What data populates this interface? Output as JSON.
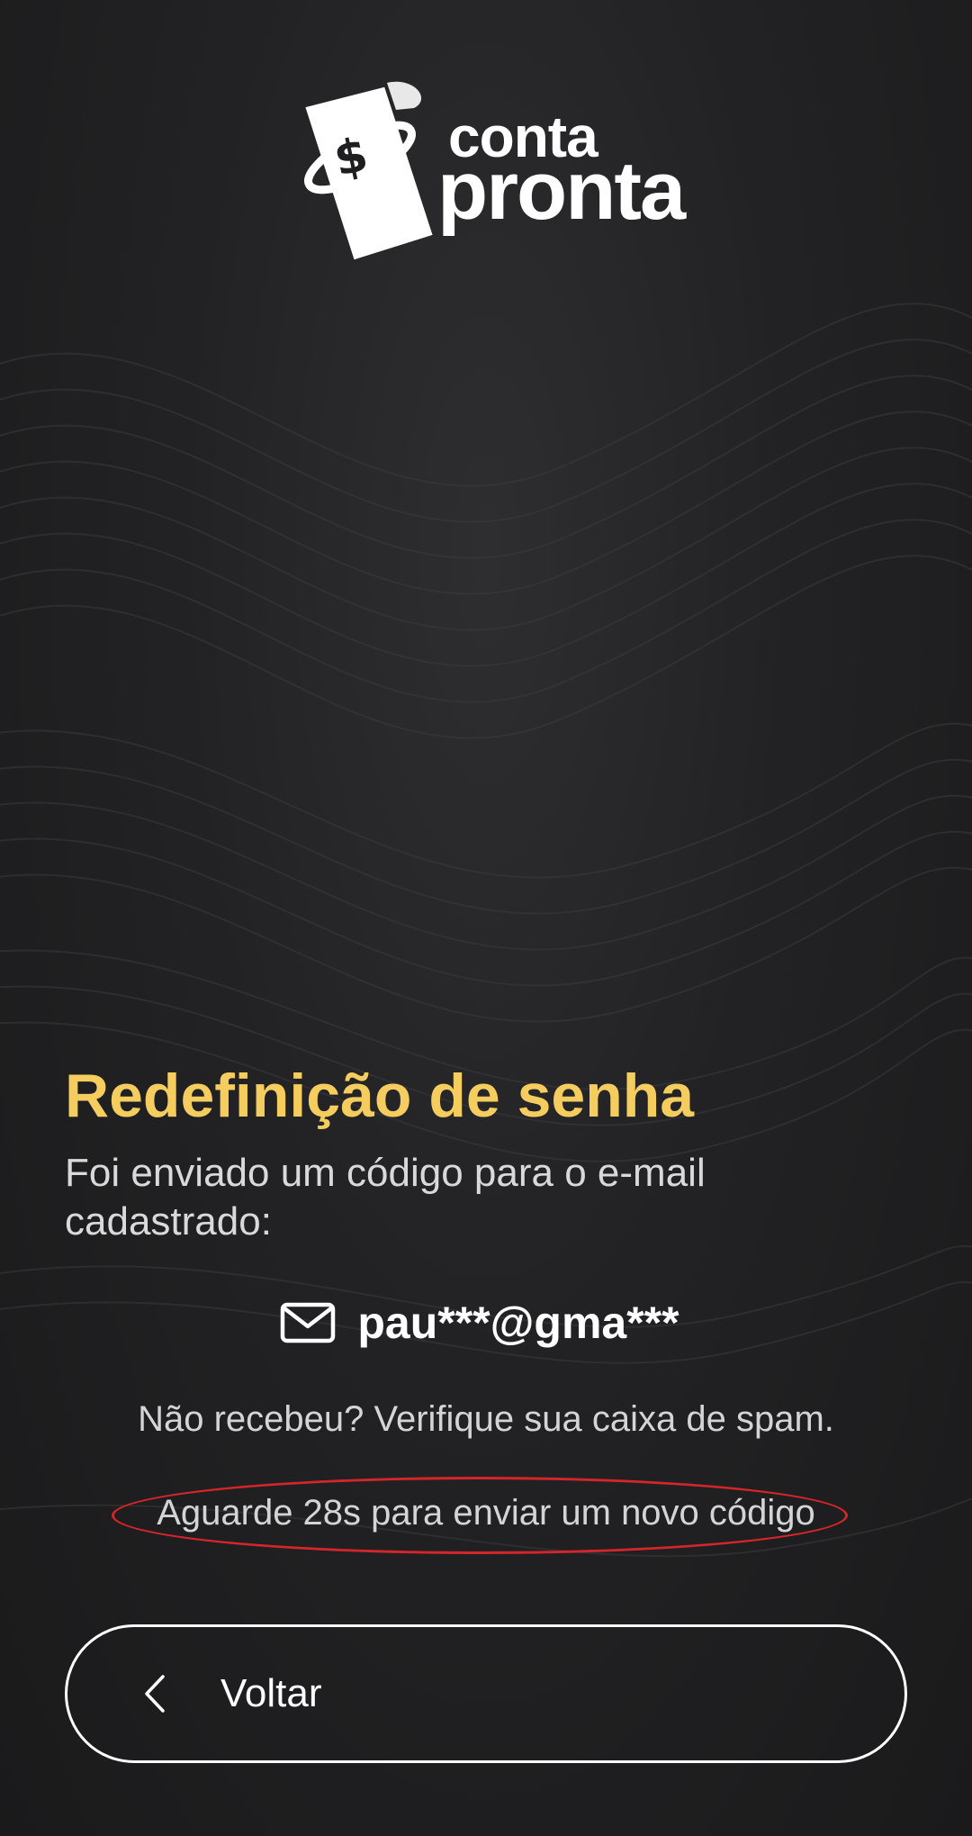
{
  "brand": {
    "line1": "conta",
    "line2": "pronta"
  },
  "heading": {
    "title": "Redefinição de senha",
    "subtitle": "Foi enviado um código para o e-mail cadastrado:"
  },
  "email": {
    "masked": "pau***@gma***",
    "icon": "mail-icon"
  },
  "spam_note": "Não recebeu? Verifique sua caixa de spam.",
  "resend": {
    "countdown_text": "Aguarde 28s para enviar um novo código"
  },
  "back_button": {
    "label": "Voltar",
    "icon": "chevron-left-icon"
  },
  "colors": {
    "accent": "#f5cd5f",
    "highlight_ring": "#d4262a",
    "background": "#1c1c1e"
  }
}
